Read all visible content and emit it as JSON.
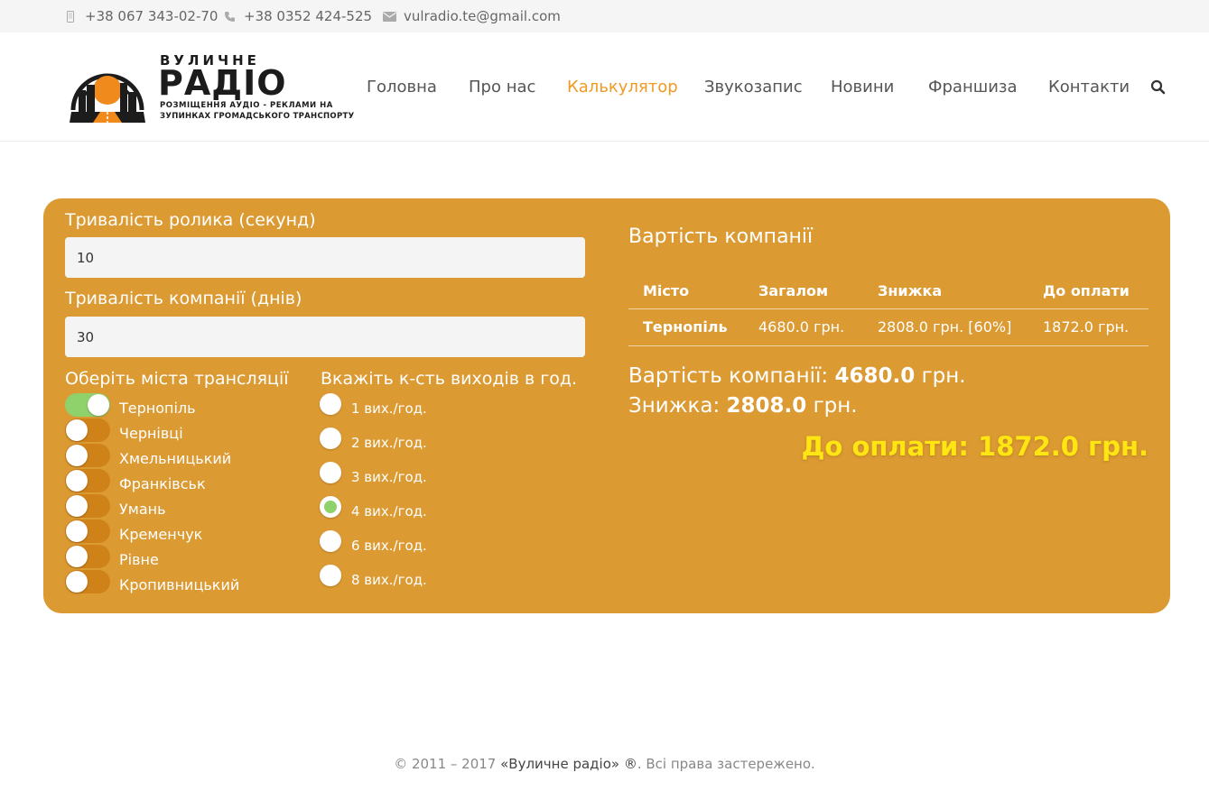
{
  "topbar": {
    "mobile": "+38 067 343-02-70",
    "phone": "+38 0352 424-525",
    "email": "vulradio.te@gmail.com"
  },
  "logo": {
    "word1": "ВУЛИЧНЕ",
    "word2": "РАДІО",
    "sub1": "РОЗМІЩЕННЯ АУДІО - РЕКЛАМИ НА",
    "sub2": "ЗУПИНКАХ ГРОМАДСЬКОГО ТРАНСПОРТУ"
  },
  "nav": {
    "items": [
      "Головна",
      "Про нас",
      "Калькулятор",
      "Звукозапис",
      "Новини",
      "Франшиза",
      "Контакти"
    ],
    "active": "Калькулятор"
  },
  "calc": {
    "duration_label": "Тривалість ролика (секунд)",
    "duration_value": "10",
    "days_label": "Тривалість компанії (днів)",
    "days_value": "30",
    "cities_label": "Оберіть міста трансляції",
    "cities": [
      {
        "name": "Тернопіль",
        "on": true
      },
      {
        "name": "Чернівці",
        "on": false
      },
      {
        "name": "Хмельницький",
        "on": false
      },
      {
        "name": "Франківськ",
        "on": false
      },
      {
        "name": "Умань",
        "on": false
      },
      {
        "name": "Кременчук",
        "on": false
      },
      {
        "name": "Рівне",
        "on": false
      },
      {
        "name": "Кропивницький",
        "on": false
      }
    ],
    "freq_label": "Вкажіть к-сть виходів в год.",
    "freqs": [
      {
        "label": "1 вих./год.",
        "selected": false
      },
      {
        "label": "2 вих./год.",
        "selected": false
      },
      {
        "label": "3 вих./год.",
        "selected": false
      },
      {
        "label": "4 вих./год.",
        "selected": true
      },
      {
        "label": "6 вих./год.",
        "selected": false
      },
      {
        "label": "8 вих./год.",
        "selected": false
      }
    ]
  },
  "result": {
    "title": "Вартість компанії",
    "headers": [
      "Місто",
      "Загалом",
      "Знижка",
      "До оплати"
    ],
    "rows": [
      [
        "Тернопіль",
        "4680.0 грн.",
        "2808.0 грн. [60%]",
        "1872.0 грн."
      ]
    ],
    "total_label": "Вартість компанії:",
    "total_value": "4680.0",
    "discount_label": "Знижка:",
    "discount_value": "2808.0",
    "currency": "грн.",
    "pay_text": "До оплати: 1872.0 грн."
  },
  "footer": {
    "prefix": "© 2011 – 2017 ",
    "brand": "«Вуличне радіо» ®",
    "suffix": ". Всі права застережено."
  },
  "colors": {
    "accent": "#f09a26",
    "panel": "#dc9a33",
    "toggle_on": "#8fd16a",
    "pay": "#ffe512"
  }
}
